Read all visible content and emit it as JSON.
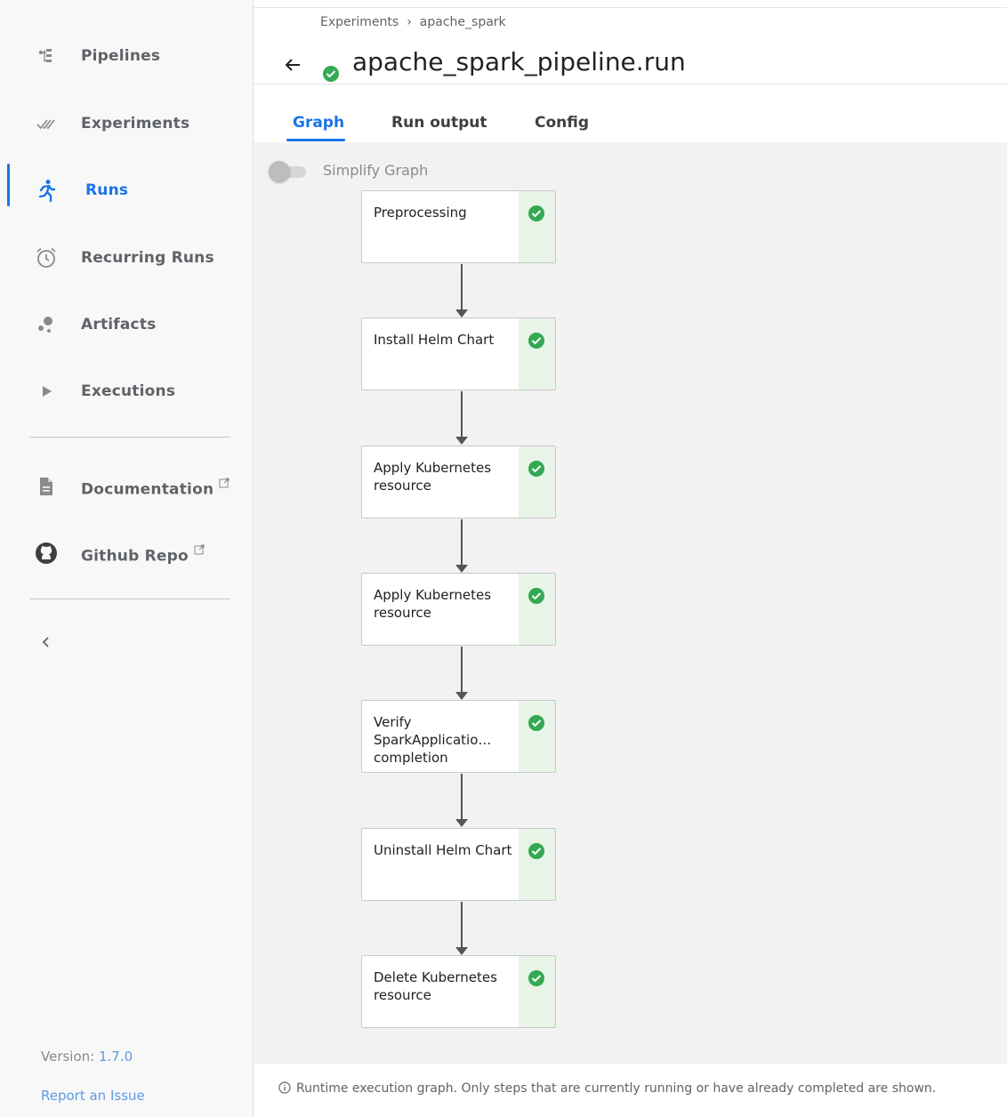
{
  "sidebar": {
    "items": [
      {
        "label": "Pipelines",
        "icon": "pipelines-icon"
      },
      {
        "label": "Experiments",
        "icon": "experiments-icon"
      },
      {
        "label": "Runs",
        "icon": "runs-icon",
        "active": true
      },
      {
        "label": "Recurring Runs",
        "icon": "alarm-clock-icon"
      },
      {
        "label": "Artifacts",
        "icon": "artifacts-icon"
      },
      {
        "label": "Executions",
        "icon": "play-icon"
      }
    ],
    "links": [
      {
        "label": "Documentation",
        "icon": "document-icon"
      },
      {
        "label": "Github Repo",
        "icon": "github-icon"
      }
    ],
    "version_label": "Version:",
    "version_value": "1.7.0",
    "report_issue": "Report an Issue"
  },
  "header": {
    "breadcrumb": [
      "Experiments",
      "apache_spark"
    ],
    "breadcrumb_separator": "›",
    "title": "apache_spark_pipeline.run",
    "status": "succeeded"
  },
  "tabs": [
    {
      "label": "Graph",
      "active": true
    },
    {
      "label": "Run output"
    },
    {
      "label": "Config"
    }
  ],
  "graph": {
    "simplify_label": "Simplify Graph",
    "simplify_enabled": false,
    "nodes": [
      {
        "label": "Preprocessing",
        "status": "succeeded"
      },
      {
        "label": "Install Helm Chart",
        "status": "succeeded"
      },
      {
        "label": "Apply Kubernetes resource",
        "status": "succeeded"
      },
      {
        "label": "Apply Kubernetes resource",
        "status": "succeeded"
      },
      {
        "label": "Verify SparkApplicatio… completion",
        "status": "succeeded"
      },
      {
        "label": "Uninstall Helm Chart",
        "status": "succeeded"
      },
      {
        "label": "Delete Kubernetes resource",
        "status": "succeeded"
      }
    ],
    "footer_note": "Runtime execution graph. Only steps that are currently running or have already completed are shown."
  },
  "colors": {
    "accent": "#1a73e8",
    "success": "#34a853",
    "success_bg": "#e7f4e7"
  }
}
